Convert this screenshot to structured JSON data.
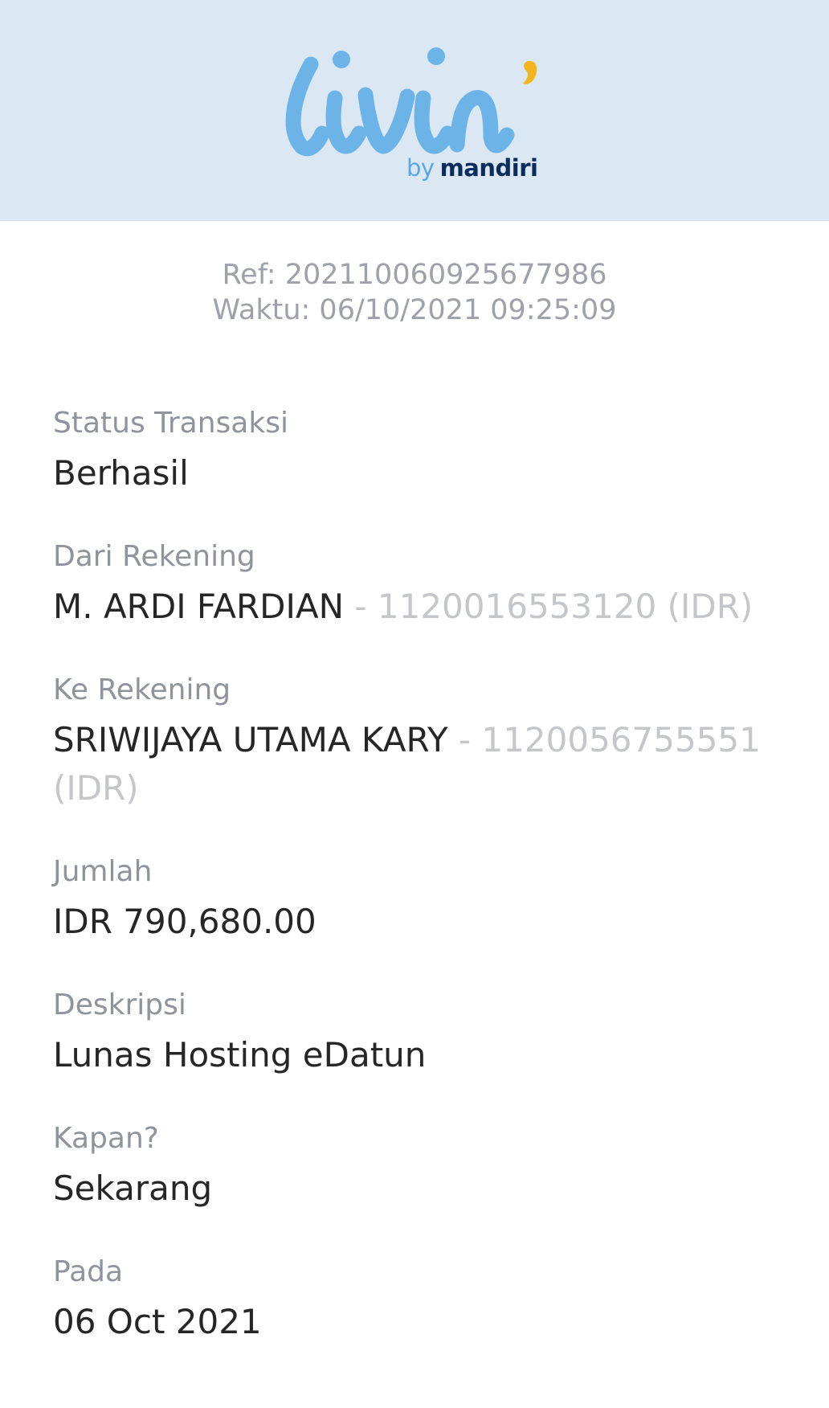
{
  "header": {
    "logo_text": "livin'",
    "by": "by",
    "brand": "mandiri",
    "colors": {
      "background": "#dbe8f4",
      "logo": "#6cb4e8",
      "accent": "#f2b51d",
      "brand": "#0b2d5b"
    }
  },
  "meta": {
    "ref": "Ref: 202110060925677986",
    "time": "Waktu: 06/10/2021 09:25:09"
  },
  "fields": {
    "status": {
      "label": "Status Transaksi",
      "value": "Berhasil"
    },
    "from": {
      "label": "Dari Rekening",
      "name": "M. ARDI FARDIAN",
      "account": " - 1120016553120 (IDR)"
    },
    "to": {
      "label": "Ke Rekening",
      "name": "SRIWIJAYA UTAMA KARY",
      "account": " - 1120056755551 (IDR)"
    },
    "amount": {
      "label": "Jumlah",
      "value": "IDR 790,680.00"
    },
    "description": {
      "label": "Deskripsi",
      "value": "Lunas Hosting eDatun"
    },
    "when": {
      "label": "Kapan?",
      "value": "Sekarang"
    },
    "date": {
      "label": "Pada",
      "value": "06 Oct 2021"
    }
  }
}
